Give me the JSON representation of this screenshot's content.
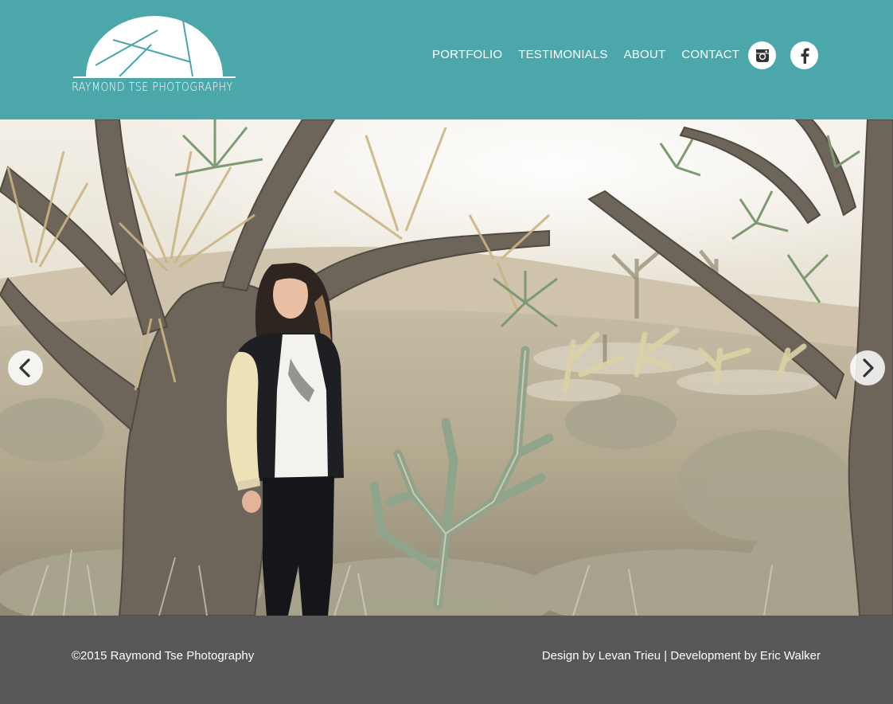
{
  "brand": {
    "logo_text": "RAYMOND TSE PHOTOGRAPHY"
  },
  "nav": {
    "items": [
      {
        "label": "PORTFOLIO"
      },
      {
        "label": "TESTIMONIALS"
      },
      {
        "label": "ABOUT"
      },
      {
        "label": "CONTACT"
      }
    ],
    "social": [
      {
        "icon": "instagram-icon"
      },
      {
        "icon": "facebook-icon"
      }
    ]
  },
  "hero": {
    "prev_icon": "chevron-left-icon",
    "next_icon": "chevron-right-icon"
  },
  "footer": {
    "copyright": "©2015 Raymond Tse Photography",
    "credits": "Design by Levan Trieu | Development by Eric Walker"
  },
  "colors": {
    "header_bg": "#4ba7aa",
    "footer_bg": "#585657"
  }
}
